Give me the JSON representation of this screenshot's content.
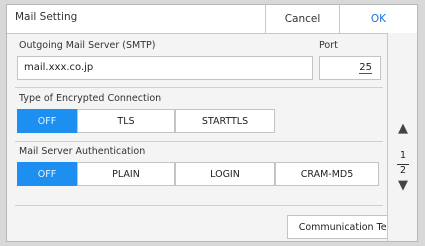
{
  "header": {
    "title": "Mail Setting",
    "cancel_label": "Cancel",
    "ok_label": "OK"
  },
  "smtp": {
    "label": "Outgoing Mail Server (SMTP)",
    "value": "mail.xxx.co.jp"
  },
  "port": {
    "label": "Port",
    "value": "25"
  },
  "encryption": {
    "label": "Type of Encrypted Connection",
    "options": [
      "OFF",
      "TLS",
      "STARTTLS"
    ],
    "selected": "OFF"
  },
  "auth": {
    "label": "Mail Server Authentication",
    "options": [
      "OFF",
      "PLAIN",
      "LOGIN",
      "CRAM-MD5"
    ],
    "selected": "OFF"
  },
  "pager": {
    "current": "1",
    "total": "2",
    "up_icon": "triangle-up",
    "down_icon": "triangle-down"
  },
  "actions": {
    "communication_test_label": "Communication Test"
  },
  "colors": {
    "accent": "#1d8ff0",
    "ok_text": "#1a73d9"
  }
}
